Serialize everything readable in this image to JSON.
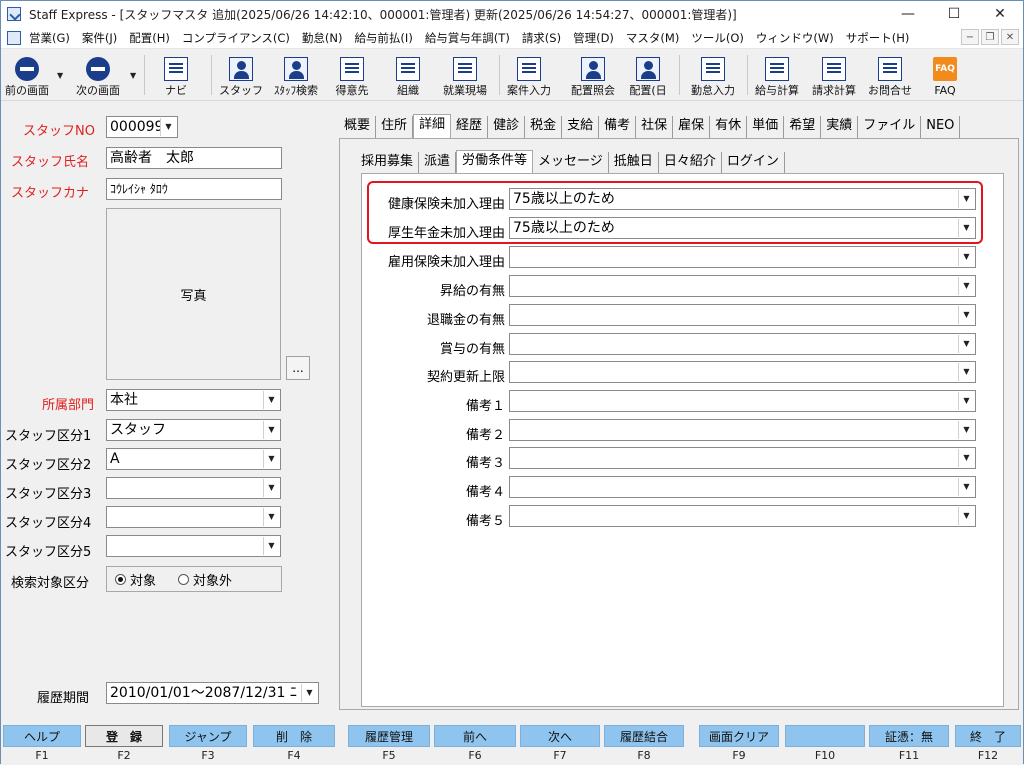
{
  "window": {
    "title": "Staff Express - [スタッフマスタ  追加(2025/06/26 14:42:10、000001:管理者)  更新(2025/06/26 14:54:27、000001:管理者)]",
    "min": "—",
    "max": "☐",
    "close": "✕"
  },
  "menu": [
    "営業(G)",
    "案件(J)",
    "配置(H)",
    "コンプライアンス(C)",
    "勤怠(N)",
    "給与前払(I)",
    "給与賞与年調(T)",
    "請求(S)",
    "管理(D)",
    "マスタ(M)",
    "ツール(O)",
    "ウィンドウ(W)",
    "サポート(H)"
  ],
  "toolbar": {
    "prev": "前の画面",
    "next": "次の画面",
    "navi": "ナビ",
    "staff": "スタッフ",
    "staff_search": "ｽﾀｯﾌ検索",
    "client": "得意先",
    "org": "組織",
    "site": "就業現場",
    "job_input": "案件入力",
    "placement_ref": "配置照会",
    "placement_day": "配置(日",
    "attendance": "勤怠入力",
    "salary": "給与計算",
    "billing": "請求計算",
    "contact": "お問合せ",
    "faq": "FAQ",
    "faq_icon": "FAQ"
  },
  "left": {
    "staff_no_label": "スタッフNO",
    "staff_no": "000099",
    "name_label": "スタッフ氏名",
    "name": "高齢者　太郎",
    "kana_label": "スタッフカナ",
    "kana": "ｺｳﾚｲｼｬ ﾀﾛｳ",
    "photo": "写真",
    "photo_btn": "...",
    "dept_label": "所属部門",
    "dept": "本社",
    "cat1_label": "スタッフ区分1",
    "cat1": "スタッフ",
    "cat2_label": "スタッフ区分2",
    "cat2": "A",
    "cat3_label": "スタッフ区分3",
    "cat3": "",
    "cat4_label": "スタッフ区分4",
    "cat4": "",
    "cat5_label": "スタッフ区分5",
    "cat5": "",
    "search_label": "検索対象区分",
    "search_on": "対象",
    "search_off": "対象外",
    "period_label": "履歴期間",
    "period": "2010/01/01～2087/12/31 ﾆ"
  },
  "tabs1": [
    "概要",
    "住所",
    "詳細",
    "経歴",
    "健診",
    "税金",
    "支給",
    "備考",
    "社保",
    "雇保",
    "有休",
    "単価",
    "希望",
    "実績",
    "ファイル",
    "NEO"
  ],
  "tabs2": [
    "採用募集",
    "派遣",
    "労働条件等",
    "メッセージ",
    "抵触日",
    "日々紹介",
    "ログイン"
  ],
  "form": {
    "health_label": "健康保険未加入理由",
    "health": "75歳以上のため",
    "pension_label": "厚生年金未加入理由",
    "pension": "75歳以上のため",
    "employment_label": "雇用保険未加入理由",
    "employment": "",
    "raise_label": "昇給の有無",
    "raise": "",
    "retire_label": "退職金の有無",
    "retire": "",
    "bonus_label": "賞与の有無",
    "bonus": "",
    "renewal_label": "契約更新上限",
    "renewal": "",
    "note1_label": "備考１",
    "note2_label": "備考２",
    "note3_label": "備考３",
    "note4_label": "備考４",
    "note5_label": "備考５"
  },
  "fkeys": [
    {
      "label": "ヘルプ",
      "key": "F1"
    },
    {
      "label": "登　録",
      "key": "F2"
    },
    {
      "label": "ジャンプ",
      "key": "F3"
    },
    {
      "label": "削　除",
      "key": "F4"
    },
    {
      "label": "履歴管理",
      "key": "F5"
    },
    {
      "label": "前へ",
      "key": "F6"
    },
    {
      "label": "次へ",
      "key": "F7"
    },
    {
      "label": "履歴結合",
      "key": "F8"
    },
    {
      "label": "画面クリア",
      "key": "F9"
    },
    {
      "label": "",
      "key": "F10"
    },
    {
      "label": "証憑：無",
      "key": "F11"
    },
    {
      "label": "終　了",
      "key": "F12"
    }
  ]
}
